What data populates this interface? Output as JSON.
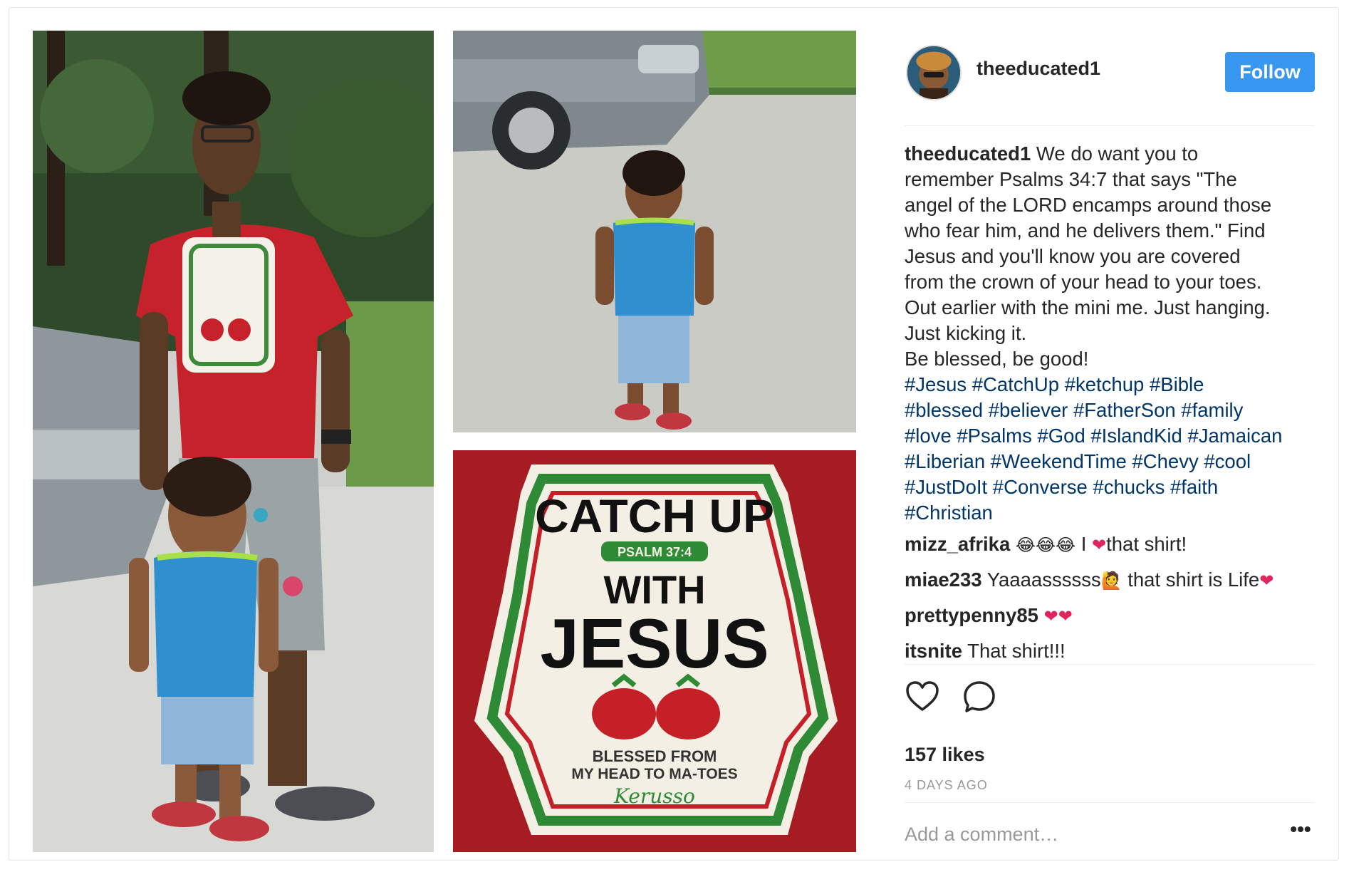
{
  "post": {
    "username": "theeducated1",
    "follow_label": "Follow",
    "caption_lines": [
      "We do want you to",
      "remember Psalms 34:7 that says \"The",
      "angel of the LORD encamps around those",
      "who fear him, and he delivers them.\" Find",
      "Jesus and you'll know you are covered",
      "from the crown of your head to your toes.",
      "Out earlier with the mini me. Just hanging.",
      "Just kicking it.",
      "Be blessed, be good!"
    ],
    "hashtag_lines": [
      "#Jesus #CatchUp #ketchup #Bible",
      "#blessed #believer #FatherSon #family",
      "#love #Psalms #God #IslandKid #Jamaican",
      "#Liberian #WeekendTime #Chevy #cool",
      "#JustDoIt #Converse #chucks #faith",
      "#Christian"
    ],
    "comments": [
      {
        "user": "mizz_afrika",
        "pre": "",
        "emoji": "😂😂😂",
        "mid": " I ",
        "heart": "❤",
        "text": "that shirt!"
      },
      {
        "user": "miae233",
        "pre": "Yaaaassssss",
        "emoji": "🙋",
        "mid": " that shirt is Life",
        "heart": "❤",
        "text": ""
      },
      {
        "user": "prettypenny85",
        "pre": "",
        "emoji": "",
        "mid": "",
        "heart": "❤❤",
        "text": ""
      },
      {
        "user": "itsnite",
        "pre": "That shirt!!!",
        "emoji": "",
        "mid": "",
        "heart": "",
        "text": ""
      }
    ],
    "likes": "157 likes",
    "timestamp": "4 DAYS AGO",
    "add_comment_placeholder": "Add a comment…",
    "more_label": "•••"
  },
  "shirt": {
    "line1": "CATCH UP",
    "ref": "PSALM 37:4",
    "line2": "WITH",
    "line3": "JESUS",
    "tag1": "BLESSED FROM",
    "tag2": "MY HEAD TO MA-TOES",
    "brand": "Kerusso"
  },
  "colors": {
    "accent": "#3897f0",
    "hashtag": "#003569",
    "heart": "#e0245e"
  }
}
